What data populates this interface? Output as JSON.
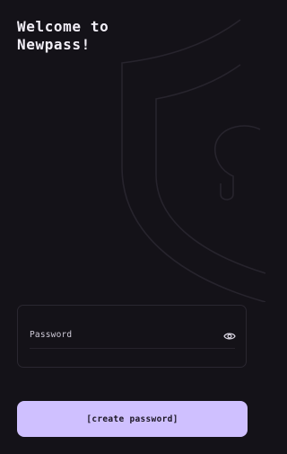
{
  "welcome": {
    "line1": "Welcome to",
    "line2": "Newpass!"
  },
  "password_field": {
    "placeholder": "Password",
    "visibility_icon": "eye-icon"
  },
  "cta": {
    "label": "[create password]"
  },
  "decoration": {
    "background_icon": "shield-keyhole-icon"
  },
  "colors": {
    "background": "#141218",
    "accent": "#cfc0ff",
    "text": "#f2eff7"
  }
}
